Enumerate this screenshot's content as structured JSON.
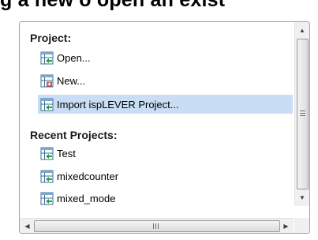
{
  "heading": {
    "text": "g a new o open an exist"
  },
  "sections": {
    "project": {
      "title": "Project:",
      "items": [
        {
          "label": "Open...",
          "icon": "open-project-icon"
        },
        {
          "label": "New...",
          "icon": "new-project-icon"
        },
        {
          "label": "Import ispLEVER Project...",
          "icon": "import-project-icon",
          "selected": true
        }
      ]
    },
    "recent": {
      "title": "Recent Projects:",
      "items": [
        {
          "label": "Test",
          "icon": "project-icon"
        },
        {
          "label": "mixedcounter",
          "icon": "project-icon"
        },
        {
          "label": "mixed_mode",
          "icon": "project-icon"
        }
      ]
    }
  },
  "scrollbar": {
    "up": "▲",
    "down": "▼",
    "left": "◀",
    "right": "▶"
  },
  "colors": {
    "selection": "#c9def5",
    "border": "#a0a0a0",
    "icon_green": "#2e9a3a"
  }
}
